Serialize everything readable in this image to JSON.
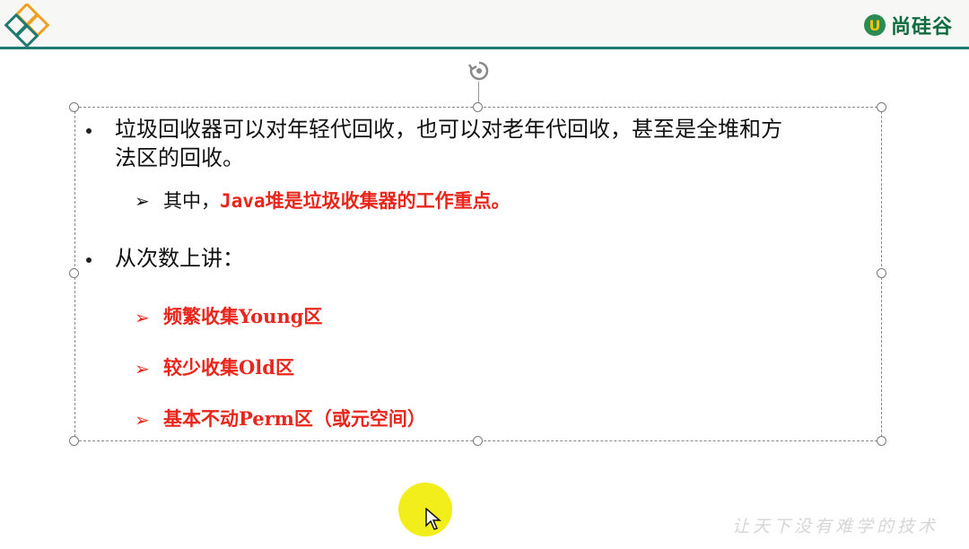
{
  "header": {
    "brand_mark": "U",
    "brand_name": "尚硅谷",
    "accent_color": "#1e7a70"
  },
  "slide": {
    "bullet1": {
      "line1": "垃圾回收器可以对年轻代回收，也可以对老年代回收，甚至是全堆和方",
      "line2": "法区的回收。"
    },
    "sub1": {
      "prefix": "其中，",
      "highlight": "Java堆是垃圾收集器的工作重点。"
    },
    "bullet2": "从次数上讲：",
    "items": [
      "频繁收集Young区",
      "较少收集Old区",
      "基本不动Perm区（或元空间）"
    ]
  },
  "watermark": "让天下没有难学的技术",
  "colors": {
    "highlight_red": "#e8261b",
    "cursor_highlight": "#f2ee1c"
  }
}
